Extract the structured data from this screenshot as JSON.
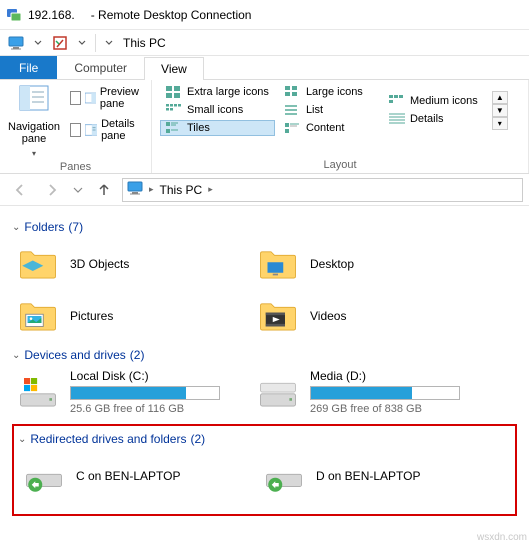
{
  "window": {
    "ip": "192.168.",
    "title_suffix": "- Remote Desktop Connection"
  },
  "qat": {
    "location": "This PC"
  },
  "tabs": {
    "file": "File",
    "computer": "Computer",
    "view": "View"
  },
  "ribbon": {
    "panes": {
      "navigation_pane": "Navigation pane",
      "preview_pane": "Preview pane",
      "details_pane": "Details pane",
      "group_label": "Panes"
    },
    "layout": {
      "extra_large_icons": "Extra large icons",
      "large_icons": "Large icons",
      "medium_icons": "Medium icons",
      "small_icons": "Small icons",
      "list": "List",
      "details": "Details",
      "tiles": "Tiles",
      "content": "Content",
      "group_label": "Layout"
    }
  },
  "breadcrumb": {
    "root": "This PC"
  },
  "sections": {
    "folders": {
      "title": "Folders",
      "count": "(7)"
    },
    "devices": {
      "title": "Devices and drives",
      "count": "(2)"
    },
    "redirected": {
      "title": "Redirected drives and folders",
      "count": "(2)"
    }
  },
  "folders": [
    {
      "name": "3D Objects",
      "icon": "3d"
    },
    {
      "name": "Desktop",
      "icon": "desktop"
    },
    {
      "name": "Pictures",
      "icon": "pictures"
    },
    {
      "name": "Videos",
      "icon": "videos"
    }
  ],
  "drives": [
    {
      "name": "Local Disk (C:)",
      "free": "25.6 GB free of 116 GB",
      "fill_pct": 78
    },
    {
      "name": "Media (D:)",
      "free": "269 GB free of 838 GB",
      "fill_pct": 68
    }
  ],
  "redirected_items": [
    {
      "name": "C on BEN-LAPTOP"
    },
    {
      "name": "D on BEN-LAPTOP"
    }
  ],
  "watermark": "wsxdn.com"
}
